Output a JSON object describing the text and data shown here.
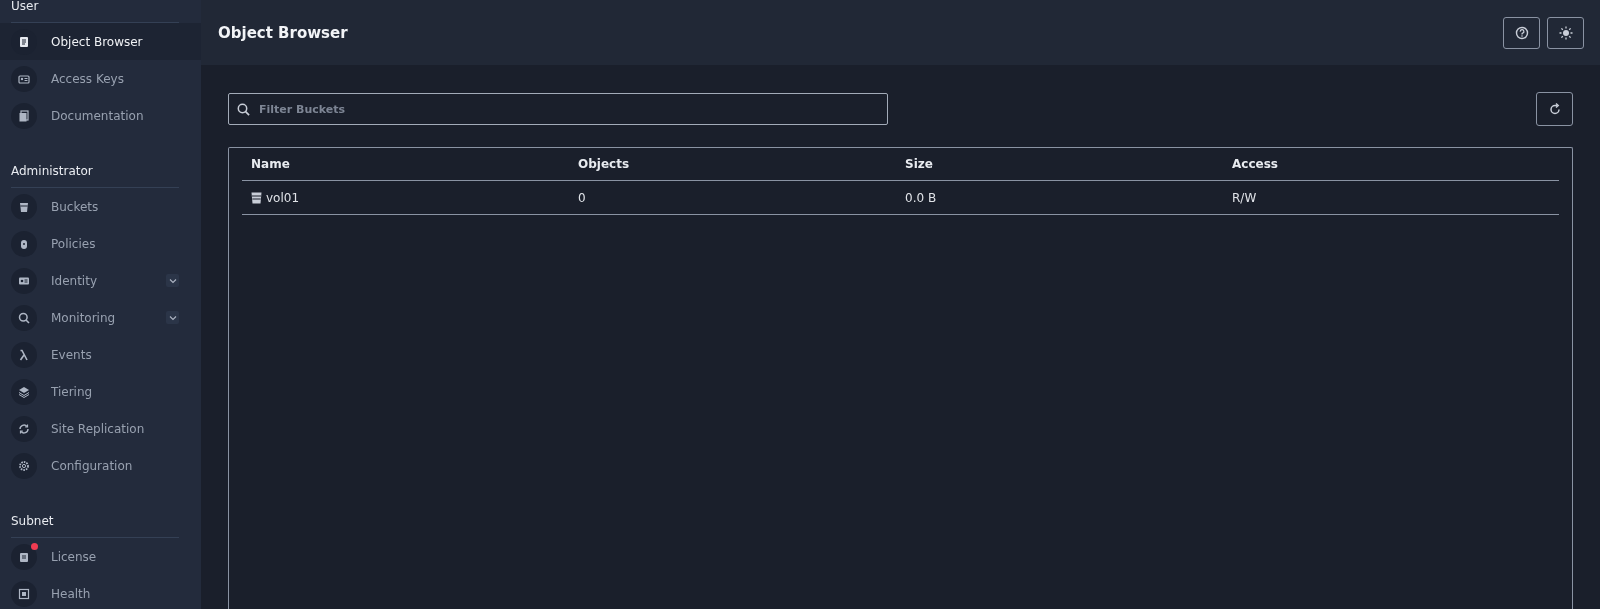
{
  "sidebar": {
    "sections": [
      {
        "title": "User",
        "items": [
          {
            "label": "Object Browser",
            "selected": true,
            "expandable": false,
            "notification": false
          },
          {
            "label": "Access Keys",
            "selected": false,
            "expandable": false,
            "notification": false
          },
          {
            "label": "Documentation",
            "selected": false,
            "expandable": false,
            "notification": false
          }
        ]
      },
      {
        "title": "Administrator",
        "items": [
          {
            "label": "Buckets",
            "selected": false,
            "expandable": false,
            "notification": false
          },
          {
            "label": "Policies",
            "selected": false,
            "expandable": false,
            "notification": false
          },
          {
            "label": "Identity",
            "selected": false,
            "expandable": true,
            "notification": false
          },
          {
            "label": "Monitoring",
            "selected": false,
            "expandable": true,
            "notification": false
          },
          {
            "label": "Events",
            "selected": false,
            "expandable": false,
            "notification": false
          },
          {
            "label": "Tiering",
            "selected": false,
            "expandable": false,
            "notification": false
          },
          {
            "label": "Site Replication",
            "selected": false,
            "expandable": false,
            "notification": false
          },
          {
            "label": "Configuration",
            "selected": false,
            "expandable": false,
            "notification": false
          }
        ]
      },
      {
        "title": "Subnet",
        "items": [
          {
            "label": "License",
            "selected": false,
            "expandable": false,
            "notification": true
          },
          {
            "label": "Health",
            "selected": false,
            "expandable": false,
            "notification": false
          }
        ]
      }
    ]
  },
  "header": {
    "title": "Object Browser"
  },
  "search": {
    "placeholder": "Filter Buckets"
  },
  "table": {
    "columns": [
      "Name",
      "Objects",
      "Size",
      "Access"
    ],
    "rows": [
      [
        "vol01",
        "0",
        "0.0 B",
        "R/W"
      ]
    ]
  }
}
